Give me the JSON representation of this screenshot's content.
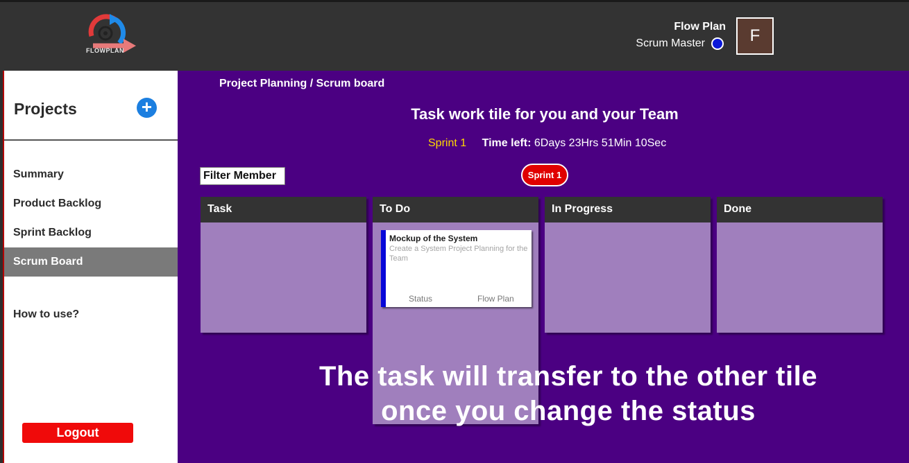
{
  "header": {
    "logo_text": "FLOWPLAN",
    "user_name": "Flow Plan",
    "user_role": "Scrum Master",
    "avatar_letter": "F"
  },
  "sidebar": {
    "title": "Projects",
    "add_symbol": "+",
    "items": [
      {
        "label": "Summary"
      },
      {
        "label": "Product Backlog"
      },
      {
        "label": "Sprint Backlog"
      },
      {
        "label": "Scrum Board"
      }
    ],
    "help": "How to use?",
    "logout": "Logout"
  },
  "main": {
    "breadcrumb": "Project Planning / Scrum board",
    "heading": "Task work tile for you and your Team",
    "sprint_name": "Sprint 1",
    "time_label": "Time left:",
    "time_value": "6Days 23Hrs 51Min 10Sec",
    "filter": "Filter Member",
    "sprint_badge": "Sprint 1",
    "columns": [
      {
        "title": "Task"
      },
      {
        "title": "To Do"
      },
      {
        "title": "In Progress"
      },
      {
        "title": "Done"
      }
    ],
    "card": {
      "title": "Mockup of the System",
      "description": "Create a System Project Planning for the Team",
      "status": "Status",
      "owner": "Flow Plan"
    },
    "overlay_line1": "The task will transfer to the other tile",
    "overlay_line2": "once you change the status"
  },
  "colors": {
    "main_bg": "#4b0082",
    "column_bg": "#a07fbd",
    "accent_blue": "#1c7fe0",
    "logout_red": "#f00a0a",
    "sprint_yellow": "#ffd800"
  }
}
